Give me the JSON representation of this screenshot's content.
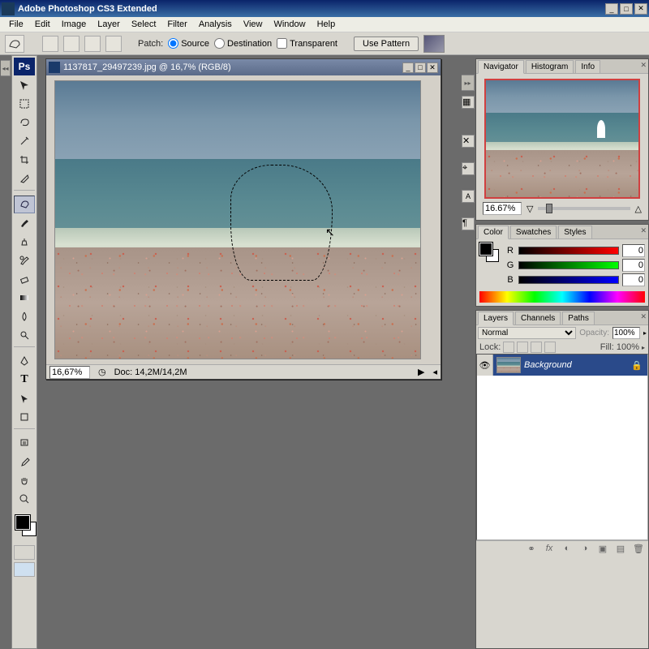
{
  "app": {
    "title": "Adobe Photoshop CS3 Extended"
  },
  "menu": [
    "File",
    "Edit",
    "Image",
    "Layer",
    "Select",
    "Filter",
    "Analysis",
    "View",
    "Window",
    "Help"
  ],
  "options": {
    "patch_label": "Patch:",
    "source": "Source",
    "destination": "Destination",
    "transparent": "Transparent",
    "use_pattern": "Use Pattern"
  },
  "document": {
    "title": "1137817_29497239.jpg @ 16,7% (RGB/8)",
    "zoom": "16,67%",
    "docinfo": "Doc: 14,2M/14,2M"
  },
  "navigator": {
    "tabs": [
      "Navigator",
      "Histogram",
      "Info"
    ],
    "zoom": "16.67%"
  },
  "color": {
    "tabs": [
      "Color",
      "Swatches",
      "Styles"
    ],
    "channels": {
      "R": "0",
      "G": "0",
      "B": "0"
    }
  },
  "layers": {
    "tabs": [
      "Layers",
      "Channels",
      "Paths"
    ],
    "blend": "Normal",
    "opacity_label": "Opacity:",
    "opacity": "100%",
    "lock_label": "Lock:",
    "fill_label": "Fill:",
    "fill": "100%",
    "items": [
      {
        "name": "Background"
      }
    ]
  },
  "tools": [
    "move",
    "rect-marquee",
    "lasso",
    "magic-wand",
    "crop",
    "slice",
    "patch",
    "spot-heal",
    "brush",
    "clone",
    "history-brush",
    "eraser",
    "gradient",
    "blur",
    "dodge",
    "pen",
    "type",
    "path-select",
    "rectangle",
    "notes",
    "eyedropper",
    "hand",
    "zoom"
  ]
}
